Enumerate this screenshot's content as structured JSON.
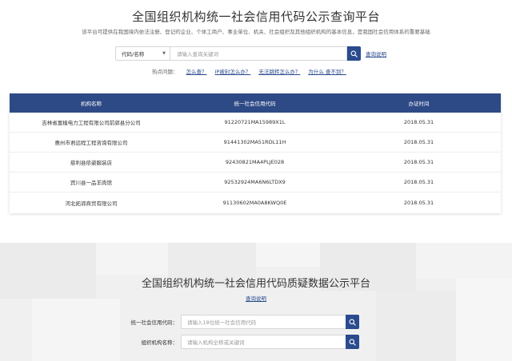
{
  "top": {
    "title": "全国组织机构统一社会信用代码公示查询平台",
    "subtitle": "该平台可提供在我国境内依法注册、登记的企业、个体工商户、事业单位、机关、社会组织及其他组织机构的基本信息，是我国社会信用体系的重要基础",
    "search": {
      "select_value": "代码/名称",
      "placeholder": "请输入查询关键词",
      "help_link": "查询说明"
    },
    "hot": {
      "label": "热点问题：",
      "links": [
        "怎么查？",
        "IP被封怎么办？",
        "无法跳转怎么办？",
        "为什么 查不到？"
      ]
    }
  },
  "table": {
    "headers": [
      "机构名称",
      "统一社会信用代码",
      "办证时间"
    ],
    "rows": [
      [
        "吉林省富植电力工程有限公司前郭县分公司",
        "91220721MA15989X1L",
        "2018.05.31"
      ],
      [
        "惠州市君远程工程咨询有限公司",
        "91441302MA51RDL11H",
        "2018.05.31"
      ],
      [
        "慈利县侬姿服装店",
        "92430821MA4PLJE028",
        "2018.05.31"
      ],
      [
        "宾川县一品羊肉馆",
        "92532924MA6N6LTDX9",
        "2018.05.31"
      ],
      [
        "河北拓谛商贸有限公司",
        "91130602MA0A8KWQ0E",
        "2018.05.31"
      ]
    ]
  },
  "bottom": {
    "title": "全国组织机构统一社会信用代码质疑数据公示平台",
    "help_link": "查询说明",
    "code_label": "统一社会信用代码：",
    "code_placeholder": "请输入18位统一社会信用代码",
    "name_label": "组织机构名称：",
    "name_placeholder": "请输入机构全称或关键词"
  },
  "colors": {
    "accent": "#2a4b8d",
    "table_header": "#2e4a86"
  },
  "icons": {
    "search": "search-icon",
    "dropdown": "chevron-down-icon"
  }
}
